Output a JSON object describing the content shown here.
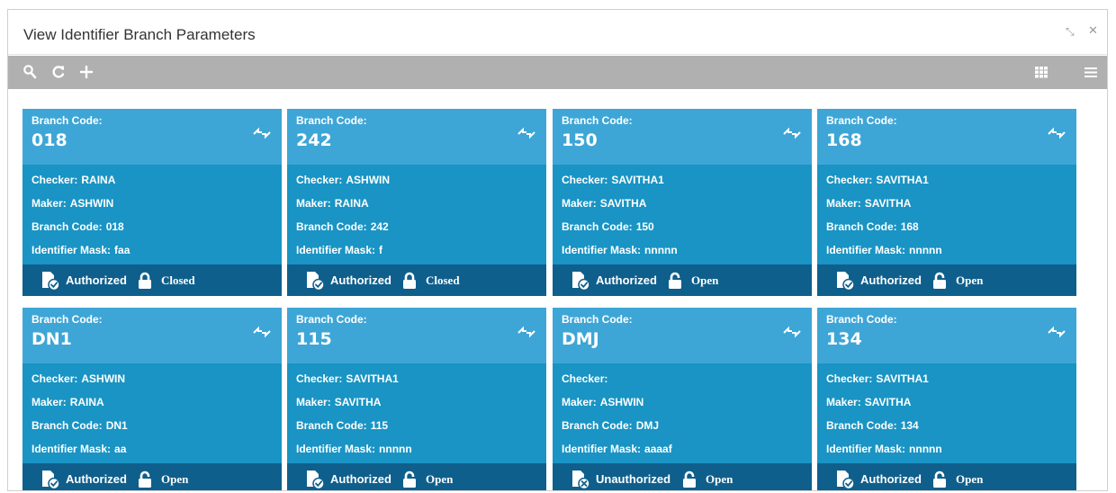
{
  "window": {
    "title": "View Identifier Branch Parameters",
    "minimize_glyph": "⤡",
    "close_glyph": "✕"
  },
  "toolbar": {
    "left_icons": [
      "search-icon",
      "refresh-icon",
      "add-icon"
    ],
    "right_icons": [
      "grid-view-icon",
      "list-view-icon"
    ]
  },
  "card_labels": {
    "head": "Branch Code:",
    "checker": "Checker:",
    "maker": "Maker:",
    "branch_code": "Branch Code:",
    "identifier_mask": "Identifier Mask:"
  },
  "colors": {
    "header": "#3ea6d6",
    "body": "#1994c4",
    "footer": "#0f5f8c",
    "toolbar": "#b0b0b0"
  },
  "cards": [
    {
      "code": "018",
      "checker": "RAINA",
      "maker": "ASHWIN",
      "branch_code": "018",
      "identifier_mask": "faa",
      "auth_status": "Authorized",
      "record_status": "Closed"
    },
    {
      "code": "242",
      "checker": "ASHWIN",
      "maker": "RAINA",
      "branch_code": "242",
      "identifier_mask": "f",
      "auth_status": "Authorized",
      "record_status": "Closed"
    },
    {
      "code": "150",
      "checker": "SAVITHA1",
      "maker": "SAVITHA",
      "branch_code": "150",
      "identifier_mask": "nnnnn",
      "auth_status": "Authorized",
      "record_status": "Open"
    },
    {
      "code": "168",
      "checker": "SAVITHA1",
      "maker": "SAVITHA",
      "branch_code": "168",
      "identifier_mask": "nnnnn",
      "auth_status": "Authorized",
      "record_status": "Open"
    },
    {
      "code": "DN1",
      "checker": "ASHWIN",
      "maker": "RAINA",
      "branch_code": "DN1",
      "identifier_mask": "aa",
      "auth_status": "Authorized",
      "record_status": "Open"
    },
    {
      "code": "115",
      "checker": "SAVITHA1",
      "maker": "SAVITHA",
      "branch_code": "115",
      "identifier_mask": "nnnnn",
      "auth_status": "Authorized",
      "record_status": "Open"
    },
    {
      "code": "DMJ",
      "checker": "",
      "maker": "ASHWIN",
      "branch_code": "DMJ",
      "identifier_mask": "aaaaf",
      "auth_status": "Unauthorized",
      "record_status": "Open"
    },
    {
      "code": "134",
      "checker": "SAVITHA1",
      "maker": "SAVITHA",
      "branch_code": "134",
      "identifier_mask": "nnnnn",
      "auth_status": "Authorized",
      "record_status": "Open"
    }
  ]
}
